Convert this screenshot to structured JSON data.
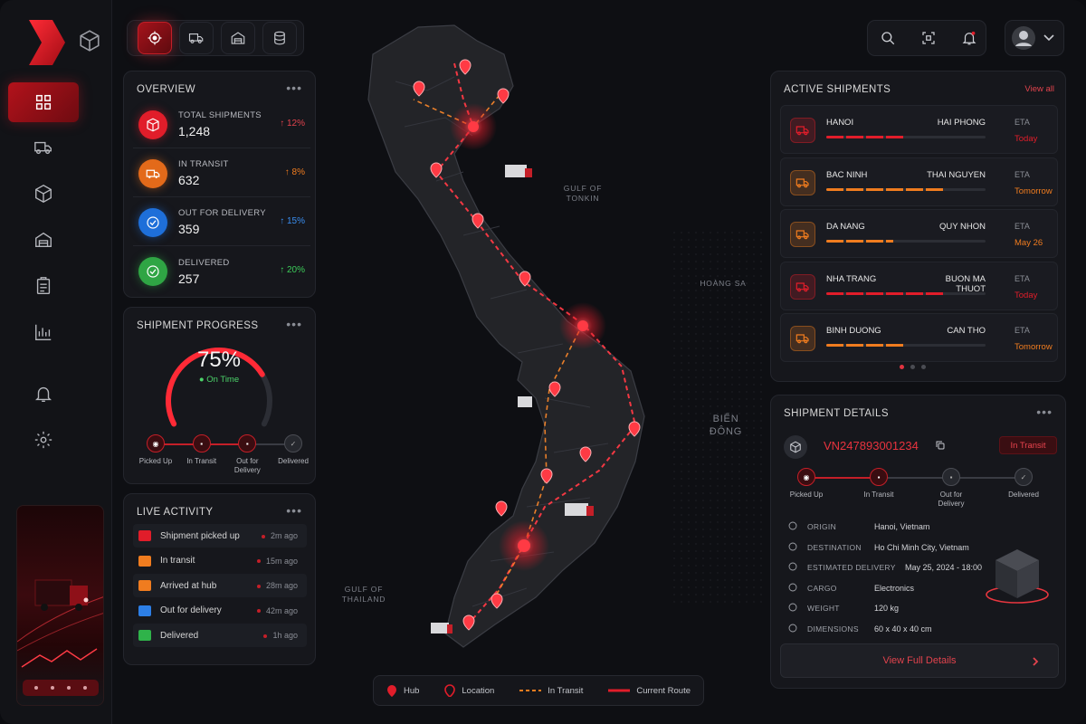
{
  "app": {
    "colors": {
      "accent": "#e11d2a",
      "orange": "#f07c1f",
      "blue": "#1e7be0",
      "green": "#2fb34a",
      "bg": "#0e0f13"
    }
  },
  "rail": {
    "icons": [
      "dashboard-icon",
      "truck-icon",
      "package-icon",
      "warehouse-icon",
      "clipboard-icon",
      "analytics-icon",
      "bell-icon",
      "gear-icon"
    ]
  },
  "topbar": {
    "tabs": [
      "tracking",
      "truck",
      "warehouse",
      "storage"
    ]
  },
  "overview": {
    "title": "OVERVIEW",
    "items": [
      {
        "label": "TOTAL SHIPMENTS",
        "value": "1,248",
        "change": "12%",
        "color": "#e11d2a",
        "change_color": "#e2434d"
      },
      {
        "label": "IN TRANSIT",
        "value": "632",
        "change": "8%",
        "color": "#e36a1a",
        "change_color": "#f07c1f"
      },
      {
        "label": "OUT FOR DELIVERY",
        "value": "359",
        "change": "15%",
        "color": "#1e6fd9",
        "change_color": "#3a8ef0"
      },
      {
        "label": "DELIVERED",
        "value": "257",
        "change": "20%",
        "color": "#2fa544",
        "change_color": "#3ccc59"
      }
    ]
  },
  "progress": {
    "title": "SHIPMENT PROGRESS",
    "percent": 75,
    "percent_label": "75%",
    "status": "On Time",
    "steps": [
      "Picked Up",
      "In Transit",
      "Out for Delivery",
      "Delivered"
    ]
  },
  "activity": {
    "title": "LIVE ACTIVITY",
    "items": [
      {
        "label": "Shipment picked up",
        "time": "2m ago",
        "color": "#e11d2a"
      },
      {
        "label": "In transit",
        "time": "15m ago",
        "color": "#f07c1f"
      },
      {
        "label": "Arrived at hub",
        "time": "28m ago",
        "color": "#f07c1f"
      },
      {
        "label": "Out for delivery",
        "time": "42m ago",
        "color": "#2d7fe6"
      },
      {
        "label": "Delivered",
        "time": "1h ago",
        "color": "#2fb34a"
      }
    ]
  },
  "map": {
    "labels": {
      "gulf_tonkin": "GULF OF\nTONKIN",
      "hoang_sa": "HOÀNG SA",
      "bien_dong": "BIỂN\nĐÔNG",
      "gulf_thailand": "GULF OF\nTHAILAND"
    },
    "legend": {
      "hub": "Hub",
      "location": "Location",
      "in_transit": "In Transit",
      "current_route": "Current Route"
    }
  },
  "shipments": {
    "title": "ACTIVE SHIPMENTS",
    "view_all": "View all",
    "eta_label": "ETA",
    "items": [
      {
        "from": "HANOI",
        "to": "HAI PHONG",
        "eta": "Today",
        "progress": 0.5,
        "color": "#e11d2a"
      },
      {
        "from": "BAC NINH",
        "to": "THAI NGUYEN",
        "eta": "Tomorrow",
        "progress": 0.75,
        "color": "#f07c1f"
      },
      {
        "from": "DA NANG",
        "to": "QUY NHON",
        "eta": "May 26",
        "progress": 0.42,
        "color": "#f07c1f"
      },
      {
        "from": "NHA TRANG",
        "to": "BUON MA THUOT",
        "eta": "Today",
        "progress": 0.75,
        "color": "#e11d2a"
      },
      {
        "from": "BINH DUONG",
        "to": "CAN THO",
        "eta": "Tomorrow",
        "progress": 0.5,
        "color": "#f07c1f"
      }
    ]
  },
  "details": {
    "title": "SHIPMENT DETAILS",
    "tracking_no": "VN247893001234",
    "status": "In Transit",
    "steps": [
      "Picked Up",
      "In Transit",
      "Out for Delivery",
      "Delivered"
    ],
    "fields": [
      {
        "key": "ORIGIN",
        "value": "Hanoi, Vietnam",
        "icon": "origin-icon"
      },
      {
        "key": "DESTINATION",
        "value": "Ho Chi Minh City, Vietnam",
        "icon": "pin-icon"
      },
      {
        "key": "ESTIMATED DELIVERY",
        "value": "May 25, 2024 - 18:00",
        "icon": "calendar-icon"
      },
      {
        "key": "CARGO",
        "value": "Electronics",
        "icon": "tag-icon"
      },
      {
        "key": "WEIGHT",
        "value": "120 kg",
        "icon": "weight-icon"
      },
      {
        "key": "DIMENSIONS",
        "value": "60 x 40 x 40 cm",
        "icon": "ruler-icon"
      }
    ],
    "button": "View Full Details"
  }
}
